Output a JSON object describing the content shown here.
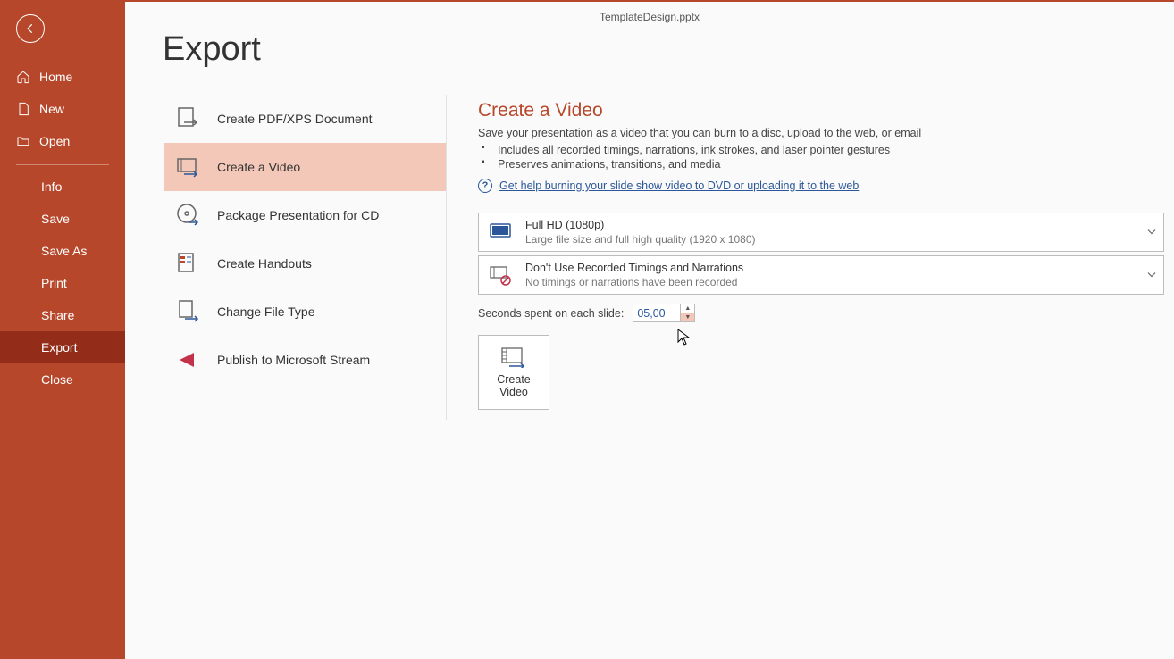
{
  "window": {
    "title": "TemplateDesign.pptx"
  },
  "sidebar": {
    "back": "Back",
    "items": [
      {
        "label": "Home",
        "icon": "home-icon"
      },
      {
        "label": "New",
        "icon": "page-icon"
      },
      {
        "label": "Open",
        "icon": "folder-icon"
      }
    ],
    "items2": [
      {
        "label": "Info"
      },
      {
        "label": "Save"
      },
      {
        "label": "Save As"
      },
      {
        "label": "Print"
      },
      {
        "label": "Share"
      },
      {
        "label": "Export",
        "selected": true
      },
      {
        "label": "Close"
      }
    ]
  },
  "page": {
    "title": "Export"
  },
  "exportList": [
    {
      "label": "Create PDF/XPS Document",
      "icon": "pdf-icon"
    },
    {
      "label": "Create a Video",
      "icon": "video-icon",
      "selected": true
    },
    {
      "label": "Package Presentation for CD",
      "icon": "cd-icon"
    },
    {
      "label": "Create Handouts",
      "icon": "handout-icon"
    },
    {
      "label": "Change File Type",
      "icon": "filetype-icon"
    },
    {
      "label": "Publish to Microsoft Stream",
      "icon": "stream-icon"
    }
  ],
  "detail": {
    "heading": "Create a Video",
    "desc": "Save your presentation as a video that you can burn to a disc, upload to the web, or email",
    "bullets": [
      "Includes all recorded timings, narrations, ink strokes, and laser pointer gestures",
      "Preserves animations, transitions, and media"
    ],
    "helpLink": "Get help burning your slide show video to DVD or uploading it to the web",
    "quality": {
      "title": "Full HD (1080p)",
      "sub": "Large file size and full high quality (1920 x 1080)"
    },
    "timings": {
      "title": "Don't Use Recorded Timings and Narrations",
      "sub": "No timings or narrations have been recorded"
    },
    "secondsLabel": "Seconds spent on each slide:",
    "secondsValue": "05,00",
    "createVideoLine1": "Create",
    "createVideoLine2": "Video"
  }
}
